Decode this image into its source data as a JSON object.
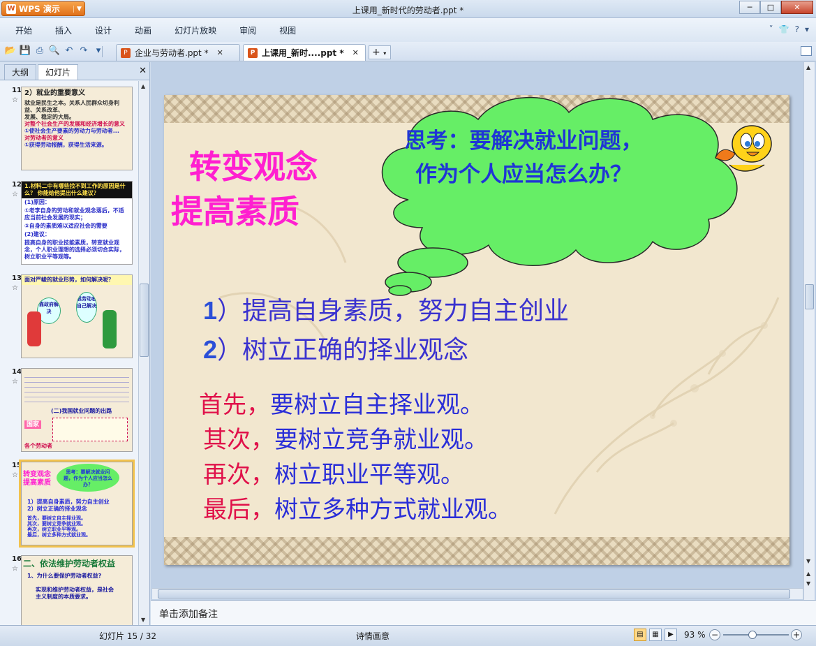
{
  "window": {
    "app_name": "WPS 演示",
    "title": "上课用_新时代的劳动者.ppt *"
  },
  "menu": [
    "开始",
    "插入",
    "设计",
    "动画",
    "幻灯片放映",
    "审阅",
    "视图"
  ],
  "doc_tabs": [
    {
      "label": "企业与劳动者.ppt *"
    },
    {
      "label": "上课用_新时....ppt *"
    }
  ],
  "panel": {
    "tabs": [
      "大纲",
      "幻灯片"
    ]
  },
  "thumbnails": [
    {
      "num": "11",
      "title": "2）就业的重要意义",
      "lines": [
        "就业是民生之本。关系人民群众切身利益、关系改革、",
        "发展、稳定的大局。",
        "对整个社会生产的发展和经济增长的意义",
        "①使社会生产要素的劳动力与劳动者...",
        "对劳动者的意义",
        "①获得劳动报酬，获得生活来源。"
      ]
    },
    {
      "num": "12",
      "title": "1.材料二中有哪些找不到工作的原因是什么？ 你能给他提出什么建议？",
      "lines": [
        "(1)原因：",
        "①老李自身的劳动和就业观念落后，不适应当前社会发展的现实；",
        "②自身的素质难以适应社会的需要",
        "(2)建议：",
        "提高自身的职业技能素质，转变就业观念，个人职业理想的选择必须切合实际，树立职业平等观等。"
      ]
    },
    {
      "num": "13",
      "title": "面对严峻的就业形势，如何解决呢？",
      "lines": [
        "靠政府解决",
        "靠劳动者自己解决"
      ]
    },
    {
      "num": "14",
      "title": "(二)我国就业问题的出路",
      "lines": [
        "国家",
        "各个劳动者"
      ]
    },
    {
      "num": "15",
      "title": "转变观念 提高素质",
      "lines": [
        "思考：要解决就业问题，作为个人应当怎么办？",
        "1）提高自身素质，努力自主创业",
        "2）树立正确的择业观念",
        "首先，要树立自主择业观。",
        "其次，要树立竞争就业观。",
        "再次，树立职业平等观。",
        "最后，树立多种方式就业观。"
      ]
    },
    {
      "num": "16",
      "title": "二、依法维护劳动者权益",
      "lines": [
        "1、为什么要保护劳动者权益?",
        "实现和维护劳动者权益，是社会主义制度的本质要求。"
      ]
    }
  ],
  "slide": {
    "title_line1": "转变观念",
    "title_line2": "提高素质",
    "thought": "思考：要解决就业问题，作为个人应当怎么办？",
    "points": [
      {
        "num": "1",
        "text": "）提高自身素质，努力自主创业"
      },
      {
        "num": "2",
        "text": "）树立正确的择业观念"
      }
    ],
    "steps": [
      {
        "key": "首先，",
        "text": "要树立自主择业观。"
      },
      {
        "key": "其次，",
        "text": "要树立竞争就业观。"
      },
      {
        "key": "再次，",
        "text": "树立职业平等观。"
      },
      {
        "key": "最后，",
        "text": "树立多种方式就业观。"
      }
    ],
    "colors": {
      "title": "#ff1fd0",
      "cloud": "#66ee66",
      "thought_text": "#1f35d6",
      "step_key": "#e0114a",
      "step_text": "#2a2ed8"
    }
  },
  "notes_placeholder": "单击添加备注",
  "status": {
    "slide_info": "幻灯片 15 / 32",
    "theme": "诗情画意",
    "zoom": "93 %"
  }
}
